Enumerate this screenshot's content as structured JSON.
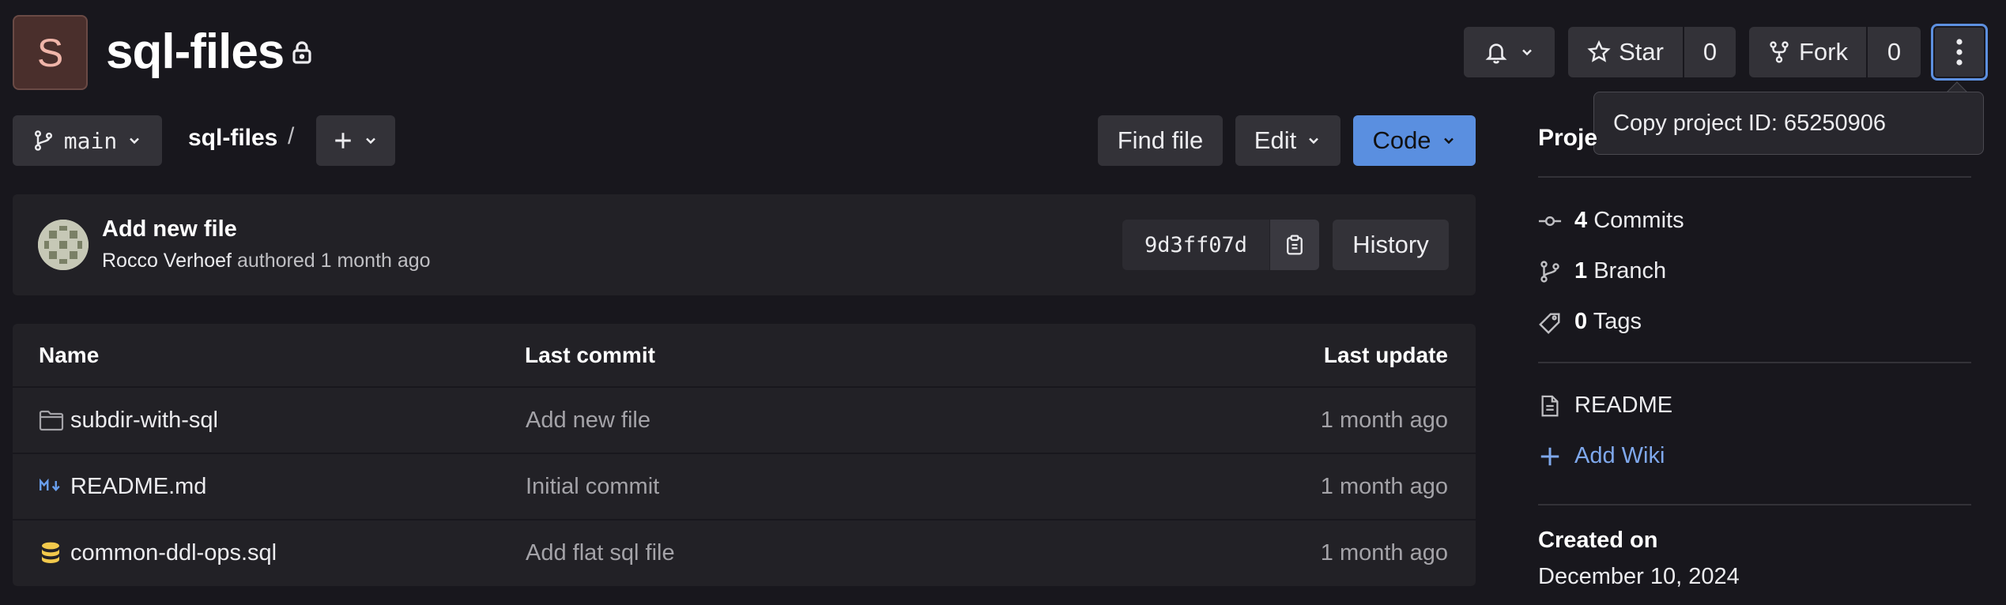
{
  "project": {
    "avatar_letter": "S",
    "name": "sql-files"
  },
  "header": {
    "star_label": "Star",
    "star_count": "0",
    "fork_label": "Fork",
    "fork_count": "0",
    "tooltip": "Copy project ID: 65250906"
  },
  "toolbar": {
    "branch": "main",
    "breadcrumb_repo": "sql-files",
    "breadcrumb_sep": "/",
    "find_file": "Find file",
    "edit": "Edit",
    "code": "Code"
  },
  "last_commit": {
    "message": "Add new file",
    "author": "Rocco Verhoef",
    "authored": "authored 1 month ago",
    "sha": "9d3ff07d",
    "history": "History"
  },
  "files": {
    "headers": {
      "name": "Name",
      "last_commit": "Last commit",
      "last_update": "Last update"
    },
    "rows": [
      {
        "icon": "folder-icon",
        "name": "subdir-with-sql",
        "commit": "Add new file",
        "updated": "1 month ago"
      },
      {
        "icon": "markdown-icon",
        "name": "README.md",
        "commit": "Initial commit",
        "updated": "1 month ago"
      },
      {
        "icon": "database-icon",
        "name": "common-ddl-ops.sql",
        "commit": "Add flat sql file",
        "updated": "1 month ago"
      }
    ]
  },
  "sidebar": {
    "title": "Proje",
    "commits_count": "4",
    "commits_label": "Commits",
    "branch_count": "1",
    "branch_label": "Branch",
    "tags_count": "0",
    "tags_label": "Tags",
    "readme": "README",
    "add_wiki": "Add Wiki",
    "created_label": "Created on",
    "created_date": "December 10, 2024"
  },
  "colors": {
    "background": "#18171d",
    "accent": "#5a8fe0",
    "link": "#7fa8ec"
  }
}
